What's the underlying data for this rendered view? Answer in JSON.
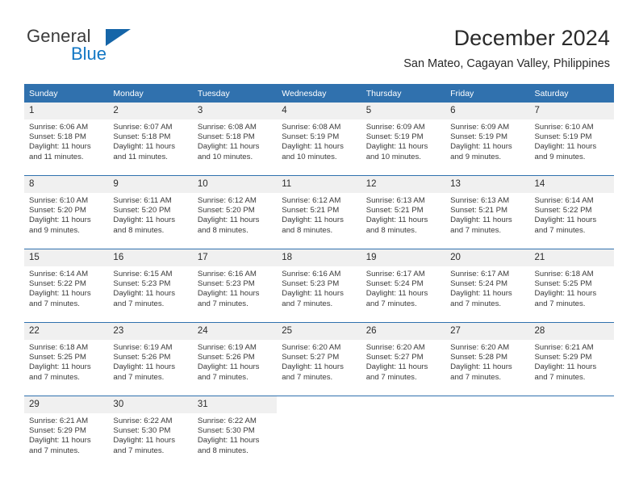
{
  "brand": {
    "line1": "General",
    "line2": "Blue",
    "flag_icon": "triangle-flag-icon"
  },
  "header": {
    "title": "December 2024",
    "location": "San Mateo, Cagayan Valley, Philippines"
  },
  "colors": {
    "header_blue": "#3071ae",
    "brand_blue": "#1277c4",
    "daynum_gray": "#f0f0f0"
  },
  "calendar": {
    "weekday_headers": [
      "Sunday",
      "Monday",
      "Tuesday",
      "Wednesday",
      "Thursday",
      "Friday",
      "Saturday"
    ],
    "weeks": [
      [
        {
          "day": "1",
          "sunrise": "Sunrise: 6:06 AM",
          "sunset": "Sunset: 5:18 PM",
          "daylight_line1": "Daylight: 11 hours",
          "daylight_line2": "and 11 minutes."
        },
        {
          "day": "2",
          "sunrise": "Sunrise: 6:07 AM",
          "sunset": "Sunset: 5:18 PM",
          "daylight_line1": "Daylight: 11 hours",
          "daylight_line2": "and 11 minutes."
        },
        {
          "day": "3",
          "sunrise": "Sunrise: 6:08 AM",
          "sunset": "Sunset: 5:18 PM",
          "daylight_line1": "Daylight: 11 hours",
          "daylight_line2": "and 10 minutes."
        },
        {
          "day": "4",
          "sunrise": "Sunrise: 6:08 AM",
          "sunset": "Sunset: 5:19 PM",
          "daylight_line1": "Daylight: 11 hours",
          "daylight_line2": "and 10 minutes."
        },
        {
          "day": "5",
          "sunrise": "Sunrise: 6:09 AM",
          "sunset": "Sunset: 5:19 PM",
          "daylight_line1": "Daylight: 11 hours",
          "daylight_line2": "and 10 minutes."
        },
        {
          "day": "6",
          "sunrise": "Sunrise: 6:09 AM",
          "sunset": "Sunset: 5:19 PM",
          "daylight_line1": "Daylight: 11 hours",
          "daylight_line2": "and 9 minutes."
        },
        {
          "day": "7",
          "sunrise": "Sunrise: 6:10 AM",
          "sunset": "Sunset: 5:19 PM",
          "daylight_line1": "Daylight: 11 hours",
          "daylight_line2": "and 9 minutes."
        }
      ],
      [
        {
          "day": "8",
          "sunrise": "Sunrise: 6:10 AM",
          "sunset": "Sunset: 5:20 PM",
          "daylight_line1": "Daylight: 11 hours",
          "daylight_line2": "and 9 minutes."
        },
        {
          "day": "9",
          "sunrise": "Sunrise: 6:11 AM",
          "sunset": "Sunset: 5:20 PM",
          "daylight_line1": "Daylight: 11 hours",
          "daylight_line2": "and 8 minutes."
        },
        {
          "day": "10",
          "sunrise": "Sunrise: 6:12 AM",
          "sunset": "Sunset: 5:20 PM",
          "daylight_line1": "Daylight: 11 hours",
          "daylight_line2": "and 8 minutes."
        },
        {
          "day": "11",
          "sunrise": "Sunrise: 6:12 AM",
          "sunset": "Sunset: 5:21 PM",
          "daylight_line1": "Daylight: 11 hours",
          "daylight_line2": "and 8 minutes."
        },
        {
          "day": "12",
          "sunrise": "Sunrise: 6:13 AM",
          "sunset": "Sunset: 5:21 PM",
          "daylight_line1": "Daylight: 11 hours",
          "daylight_line2": "and 8 minutes."
        },
        {
          "day": "13",
          "sunrise": "Sunrise: 6:13 AM",
          "sunset": "Sunset: 5:21 PM",
          "daylight_line1": "Daylight: 11 hours",
          "daylight_line2": "and 7 minutes."
        },
        {
          "day": "14",
          "sunrise": "Sunrise: 6:14 AM",
          "sunset": "Sunset: 5:22 PM",
          "daylight_line1": "Daylight: 11 hours",
          "daylight_line2": "and 7 minutes."
        }
      ],
      [
        {
          "day": "15",
          "sunrise": "Sunrise: 6:14 AM",
          "sunset": "Sunset: 5:22 PM",
          "daylight_line1": "Daylight: 11 hours",
          "daylight_line2": "and 7 minutes."
        },
        {
          "day": "16",
          "sunrise": "Sunrise: 6:15 AM",
          "sunset": "Sunset: 5:23 PM",
          "daylight_line1": "Daylight: 11 hours",
          "daylight_line2": "and 7 minutes."
        },
        {
          "day": "17",
          "sunrise": "Sunrise: 6:16 AM",
          "sunset": "Sunset: 5:23 PM",
          "daylight_line1": "Daylight: 11 hours",
          "daylight_line2": "and 7 minutes."
        },
        {
          "day": "18",
          "sunrise": "Sunrise: 6:16 AM",
          "sunset": "Sunset: 5:23 PM",
          "daylight_line1": "Daylight: 11 hours",
          "daylight_line2": "and 7 minutes."
        },
        {
          "day": "19",
          "sunrise": "Sunrise: 6:17 AM",
          "sunset": "Sunset: 5:24 PM",
          "daylight_line1": "Daylight: 11 hours",
          "daylight_line2": "and 7 minutes."
        },
        {
          "day": "20",
          "sunrise": "Sunrise: 6:17 AM",
          "sunset": "Sunset: 5:24 PM",
          "daylight_line1": "Daylight: 11 hours",
          "daylight_line2": "and 7 minutes."
        },
        {
          "day": "21",
          "sunrise": "Sunrise: 6:18 AM",
          "sunset": "Sunset: 5:25 PM",
          "daylight_line1": "Daylight: 11 hours",
          "daylight_line2": "and 7 minutes."
        }
      ],
      [
        {
          "day": "22",
          "sunrise": "Sunrise: 6:18 AM",
          "sunset": "Sunset: 5:25 PM",
          "daylight_line1": "Daylight: 11 hours",
          "daylight_line2": "and 7 minutes."
        },
        {
          "day": "23",
          "sunrise": "Sunrise: 6:19 AM",
          "sunset": "Sunset: 5:26 PM",
          "daylight_line1": "Daylight: 11 hours",
          "daylight_line2": "and 7 minutes."
        },
        {
          "day": "24",
          "sunrise": "Sunrise: 6:19 AM",
          "sunset": "Sunset: 5:26 PM",
          "daylight_line1": "Daylight: 11 hours",
          "daylight_line2": "and 7 minutes."
        },
        {
          "day": "25",
          "sunrise": "Sunrise: 6:20 AM",
          "sunset": "Sunset: 5:27 PM",
          "daylight_line1": "Daylight: 11 hours",
          "daylight_line2": "and 7 minutes."
        },
        {
          "day": "26",
          "sunrise": "Sunrise: 6:20 AM",
          "sunset": "Sunset: 5:27 PM",
          "daylight_line1": "Daylight: 11 hours",
          "daylight_line2": "and 7 minutes."
        },
        {
          "day": "27",
          "sunrise": "Sunrise: 6:20 AM",
          "sunset": "Sunset: 5:28 PM",
          "daylight_line1": "Daylight: 11 hours",
          "daylight_line2": "and 7 minutes."
        },
        {
          "day": "28",
          "sunrise": "Sunrise: 6:21 AM",
          "sunset": "Sunset: 5:29 PM",
          "daylight_line1": "Daylight: 11 hours",
          "daylight_line2": "and 7 minutes."
        }
      ],
      [
        {
          "day": "29",
          "sunrise": "Sunrise: 6:21 AM",
          "sunset": "Sunset: 5:29 PM",
          "daylight_line1": "Daylight: 11 hours",
          "daylight_line2": "and 7 minutes."
        },
        {
          "day": "30",
          "sunrise": "Sunrise: 6:22 AM",
          "sunset": "Sunset: 5:30 PM",
          "daylight_line1": "Daylight: 11 hours",
          "daylight_line2": "and 7 minutes."
        },
        {
          "day": "31",
          "sunrise": "Sunrise: 6:22 AM",
          "sunset": "Sunset: 5:30 PM",
          "daylight_line1": "Daylight: 11 hours",
          "daylight_line2": "and 8 minutes."
        },
        {
          "day": "",
          "sunrise": "",
          "sunset": "",
          "daylight_line1": "",
          "daylight_line2": ""
        },
        {
          "day": "",
          "sunrise": "",
          "sunset": "",
          "daylight_line1": "",
          "daylight_line2": ""
        },
        {
          "day": "",
          "sunrise": "",
          "sunset": "",
          "daylight_line1": "",
          "daylight_line2": ""
        },
        {
          "day": "",
          "sunrise": "",
          "sunset": "",
          "daylight_line1": "",
          "daylight_line2": ""
        }
      ]
    ]
  }
}
